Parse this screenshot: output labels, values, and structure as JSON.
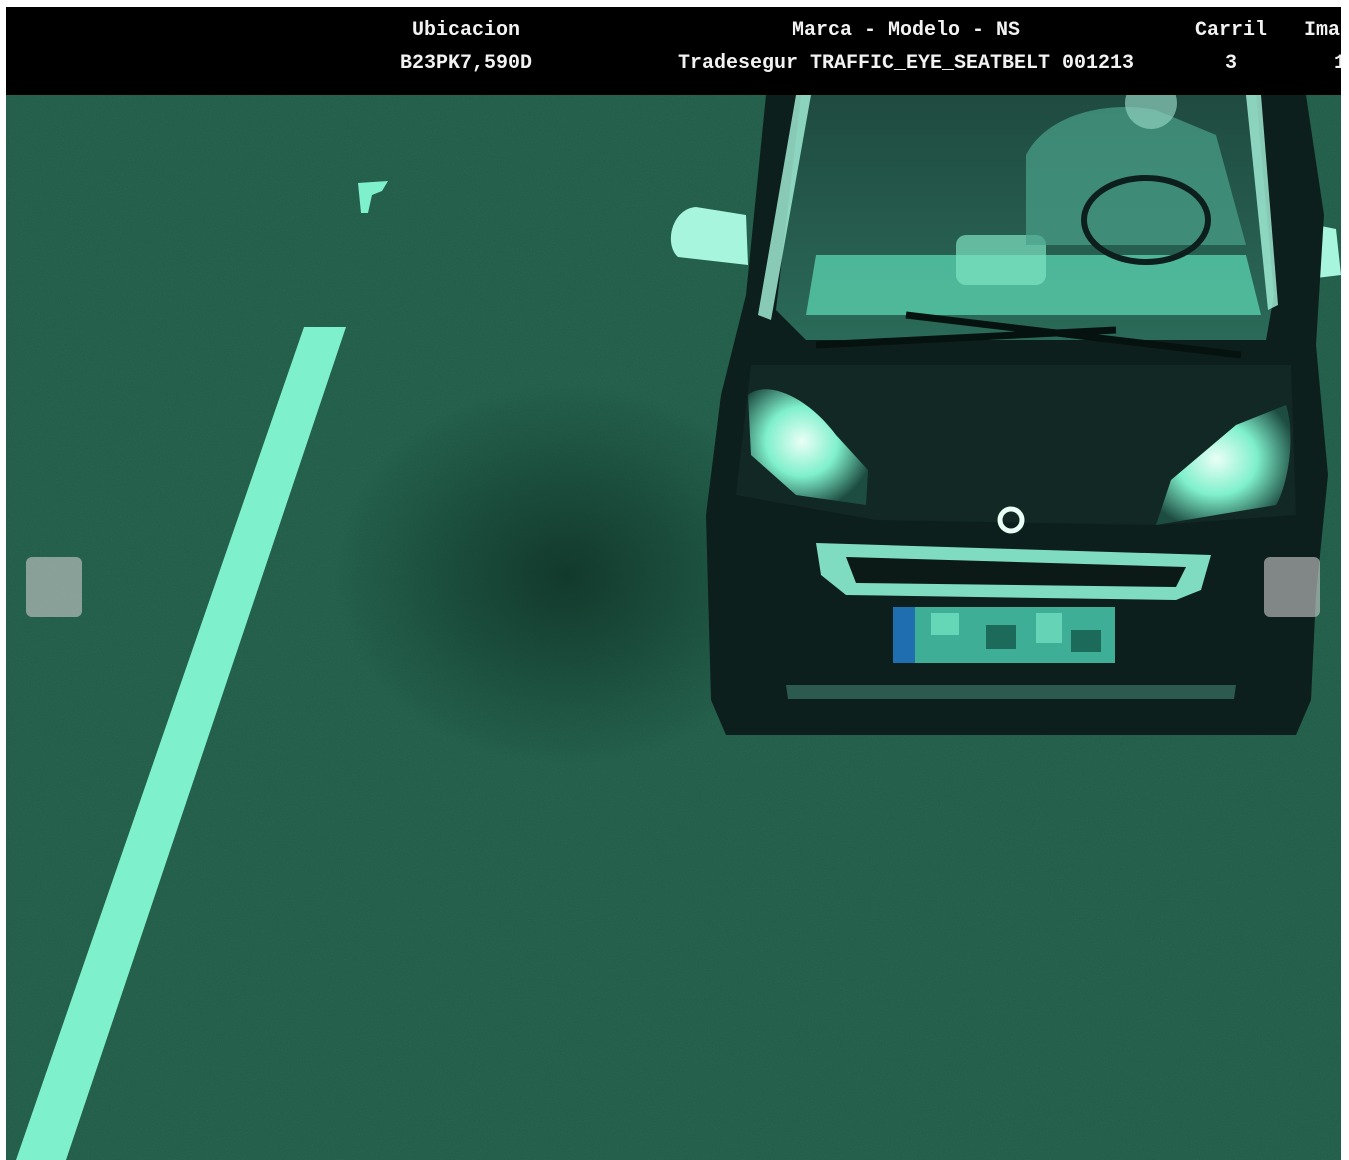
{
  "overlay": {
    "columns": [
      {
        "header": "Ubicacion",
        "value": "B23PK7,590D"
      },
      {
        "header": "Marca - Modelo - NS",
        "value": "Tradesegur TRAFFIC_EYE_SEATBELT 001213"
      },
      {
        "header": "Carril",
        "value": "3"
      },
      {
        "header": "Ima",
        "value": "1"
      }
    ]
  },
  "gallery": {
    "prev_icon": "previous-slide-icon",
    "next_icon": "next-slide-icon"
  },
  "colors": {
    "road": "#1e5a45",
    "lane_marking": "#7ff0cc",
    "car_body": "#0d1f1c",
    "overlay_bg": "#000000",
    "overlay_text": "#f2f2f2"
  }
}
